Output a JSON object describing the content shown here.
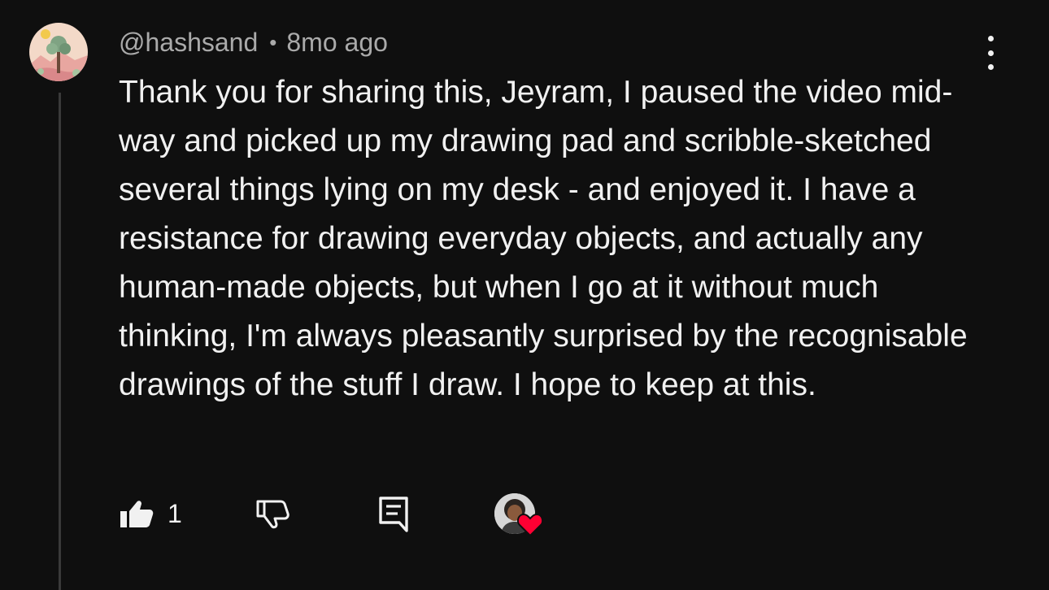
{
  "comment": {
    "author": "@hashsand",
    "separator": "•",
    "timestamp": "8mo ago",
    "text": "Thank you for sharing this, Jeyram, I paused the video mid-way and picked up my drawing pad and scribble-sketched several things lying on my desk - and enjoyed it. I have a resistance for drawing everyday objects, and actually any human-made objects, but when I go at it without much thinking, I'm always pleasantly surprised by the recognisable drawings of the stuff I draw. I hope to keep at this.",
    "like_count": "1"
  },
  "icons": {
    "like": "thumbs-up-icon",
    "dislike": "thumbs-down-icon",
    "reply": "reply-comment-icon",
    "more": "more-vertical-icon",
    "heart": "heart-icon"
  },
  "colors": {
    "background": "#0f0f0f",
    "text": "#f1f1f1",
    "meta": "#aaaaaa",
    "heart": "#ff0033"
  }
}
